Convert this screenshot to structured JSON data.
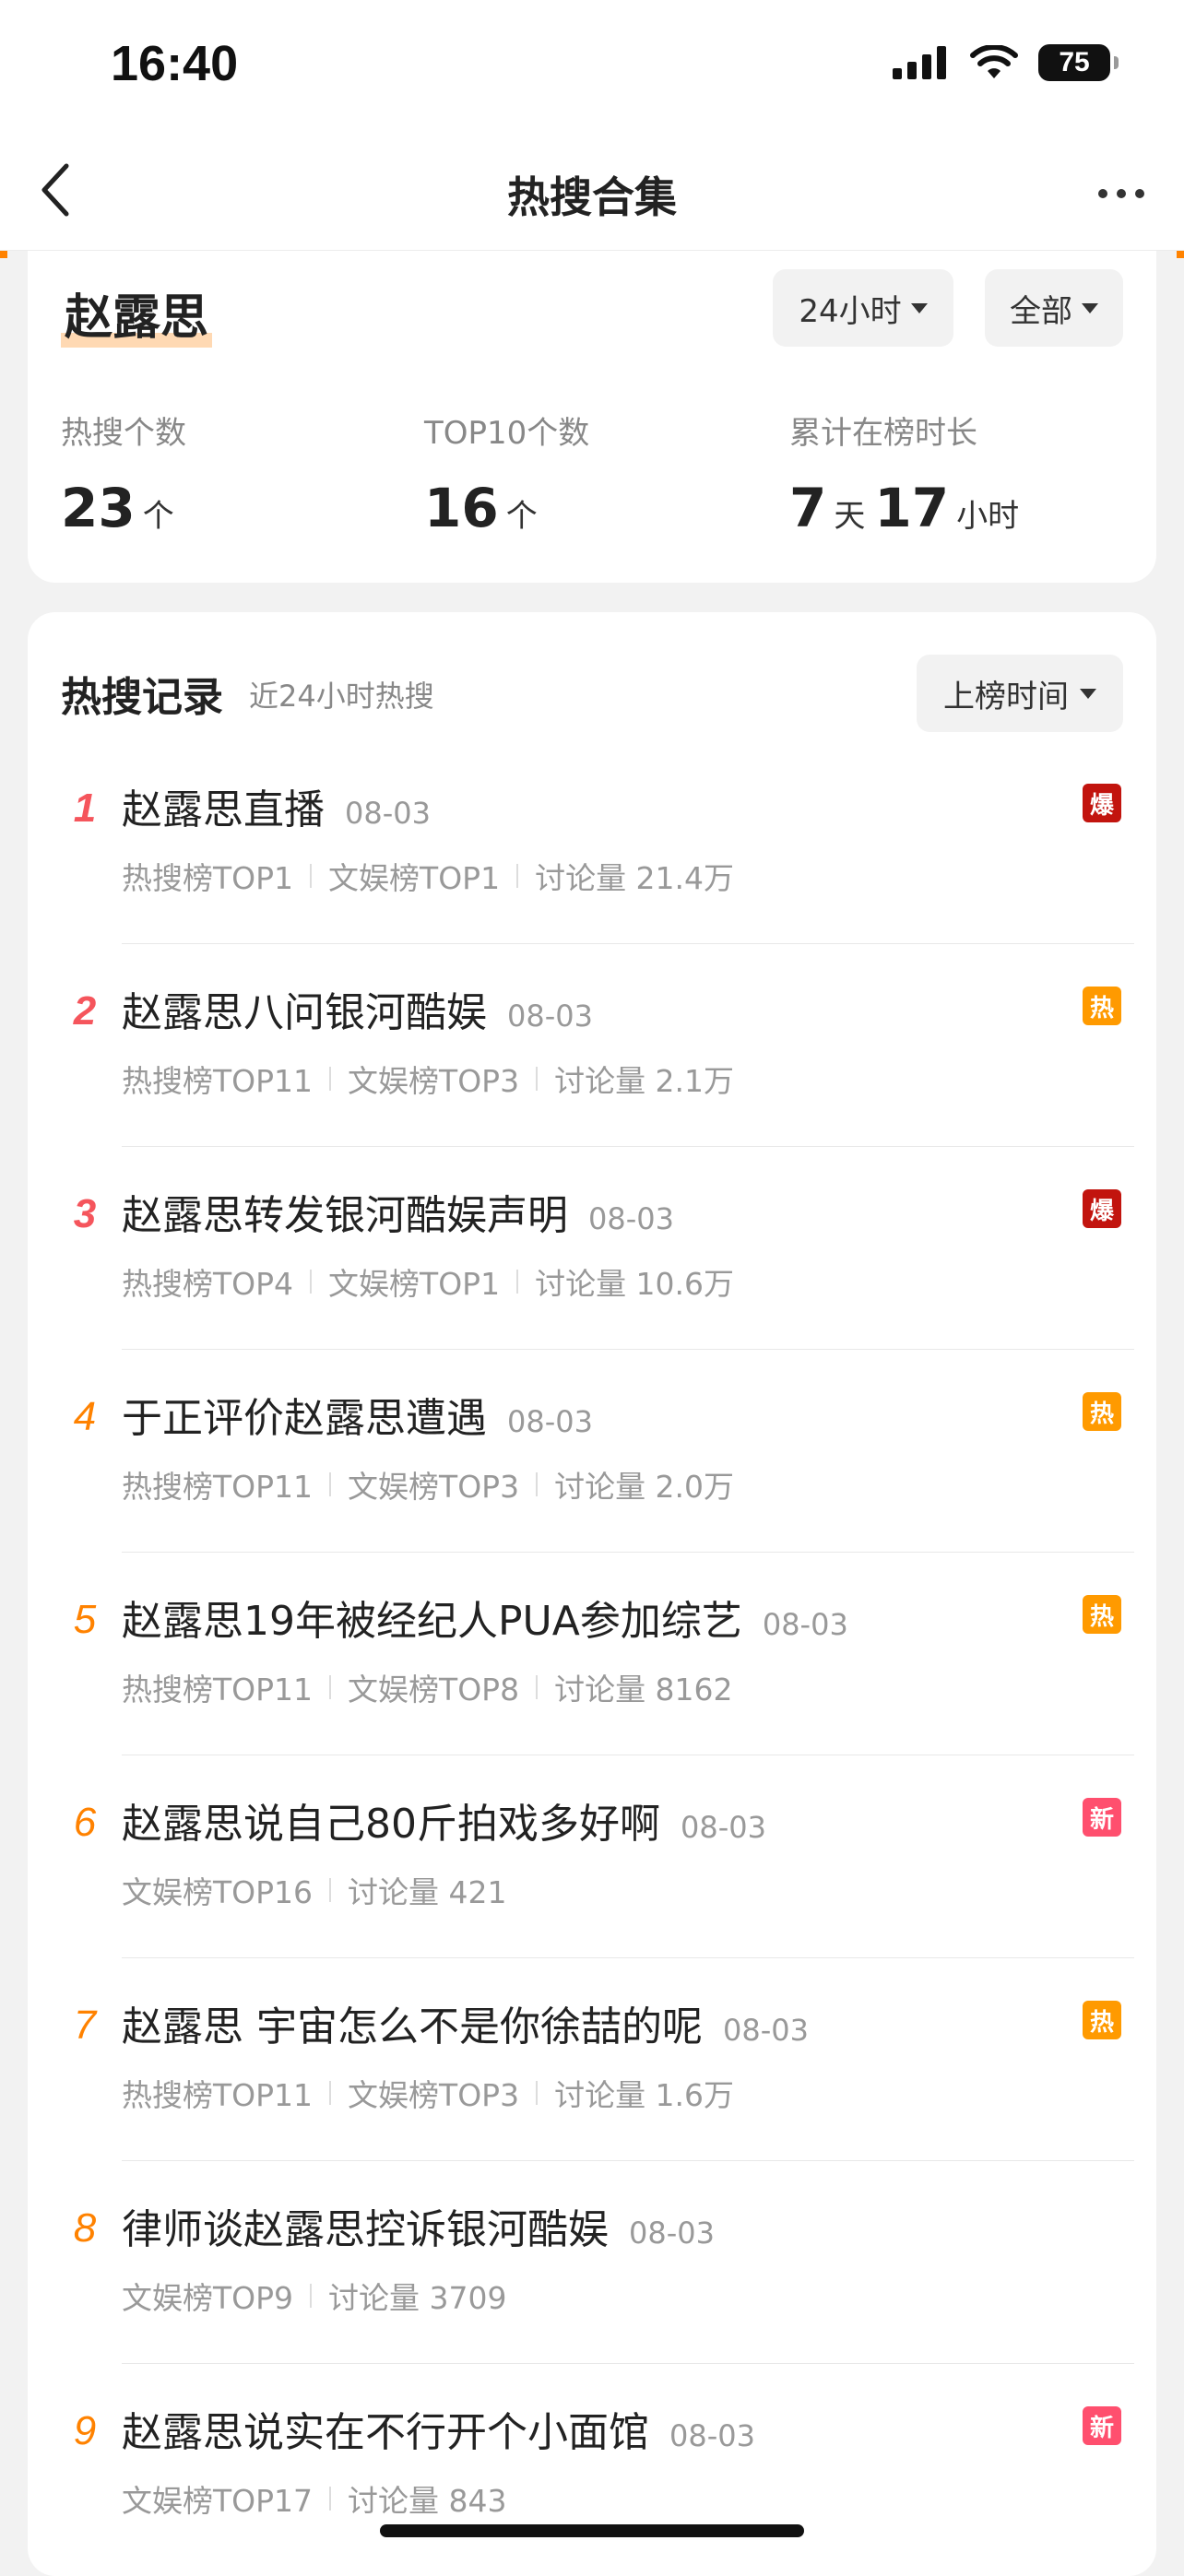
{
  "status_bar": {
    "time": "16:40",
    "battery": "75"
  },
  "nav": {
    "title": "热搜合集"
  },
  "summary": {
    "name": "赵露思",
    "filters": {
      "time_range": "24小时",
      "scope": "全部"
    },
    "stats": [
      {
        "label": "热搜个数",
        "value": "23",
        "unit": "个"
      },
      {
        "label": "TOP10个数",
        "value": "16",
        "unit": "个"
      },
      {
        "label": "累计在榜时长",
        "days": "7",
        "days_unit": "天",
        "hours": "17",
        "hours_unit": "小时"
      }
    ]
  },
  "records": {
    "title": "热搜记录",
    "subtitle": "近24小时热搜",
    "sort_label": "上榜时间",
    "items": [
      {
        "rank": "1",
        "title": "赵露思直播",
        "date": "08-03",
        "meta": [
          "热搜榜TOP1",
          "文娱榜TOP1",
          "讨论量 21.4万"
        ],
        "badge": "爆",
        "badge_color": "#c2140e"
      },
      {
        "rank": "2",
        "title": "赵露思八问银河酷娱",
        "date": "08-03",
        "meta": [
          "热搜榜TOP11",
          "文娱榜TOP3",
          "讨论量 2.1万"
        ],
        "badge": "热",
        "badge_color": "#ff9a00"
      },
      {
        "rank": "3",
        "title": "赵露思转发银河酷娱声明",
        "date": "08-03",
        "meta": [
          "热搜榜TOP4",
          "文娱榜TOP1",
          "讨论量 10.6万"
        ],
        "badge": "爆",
        "badge_color": "#c2140e"
      },
      {
        "rank": "4",
        "title": "于正评价赵露思遭遇",
        "date": "08-03",
        "meta": [
          "热搜榜TOP11",
          "文娱榜TOP3",
          "讨论量 2.0万"
        ],
        "badge": "热",
        "badge_color": "#ff9a00"
      },
      {
        "rank": "5",
        "title": "赵露思19年被经纪人PUA参加综艺",
        "date": "08-03",
        "meta": [
          "热搜榜TOP11",
          "文娱榜TOP8",
          "讨论量 8162"
        ],
        "badge": "热",
        "badge_color": "#ff9a00"
      },
      {
        "rank": "6",
        "title": "赵露思说自己80斤拍戏多好啊",
        "date": "08-03",
        "meta": [
          "文娱榜TOP16",
          "讨论量 421"
        ],
        "badge": "新",
        "badge_color": "#ff4f6e"
      },
      {
        "rank": "7",
        "title": "赵露思 宇宙怎么不是你徐喆的呢",
        "date": "08-03",
        "meta": [
          "热搜榜TOP11",
          "文娱榜TOP3",
          "讨论量 1.6万"
        ],
        "badge": "热",
        "badge_color": "#ff9a00"
      },
      {
        "rank": "8",
        "title": "律师谈赵露思控诉银河酷娱",
        "date": "08-03",
        "meta": [
          "文娱榜TOP9",
          "讨论量 3709"
        ],
        "badge": "",
        "badge_color": ""
      },
      {
        "rank": "9",
        "title": "赵露思说实在不行开个小面馆",
        "date": "08-03",
        "meta": [
          "文娱榜TOP17",
          "讨论量 843"
        ],
        "badge": "新",
        "badge_color": "#ff4f6e"
      }
    ]
  },
  "icons": {
    "back": "back-arrow-icon",
    "more": "more-dots-icon",
    "signal": "signal-icon",
    "wifi": "wifi-icon",
    "battery": "battery-icon",
    "caret": "caret-down-icon"
  }
}
